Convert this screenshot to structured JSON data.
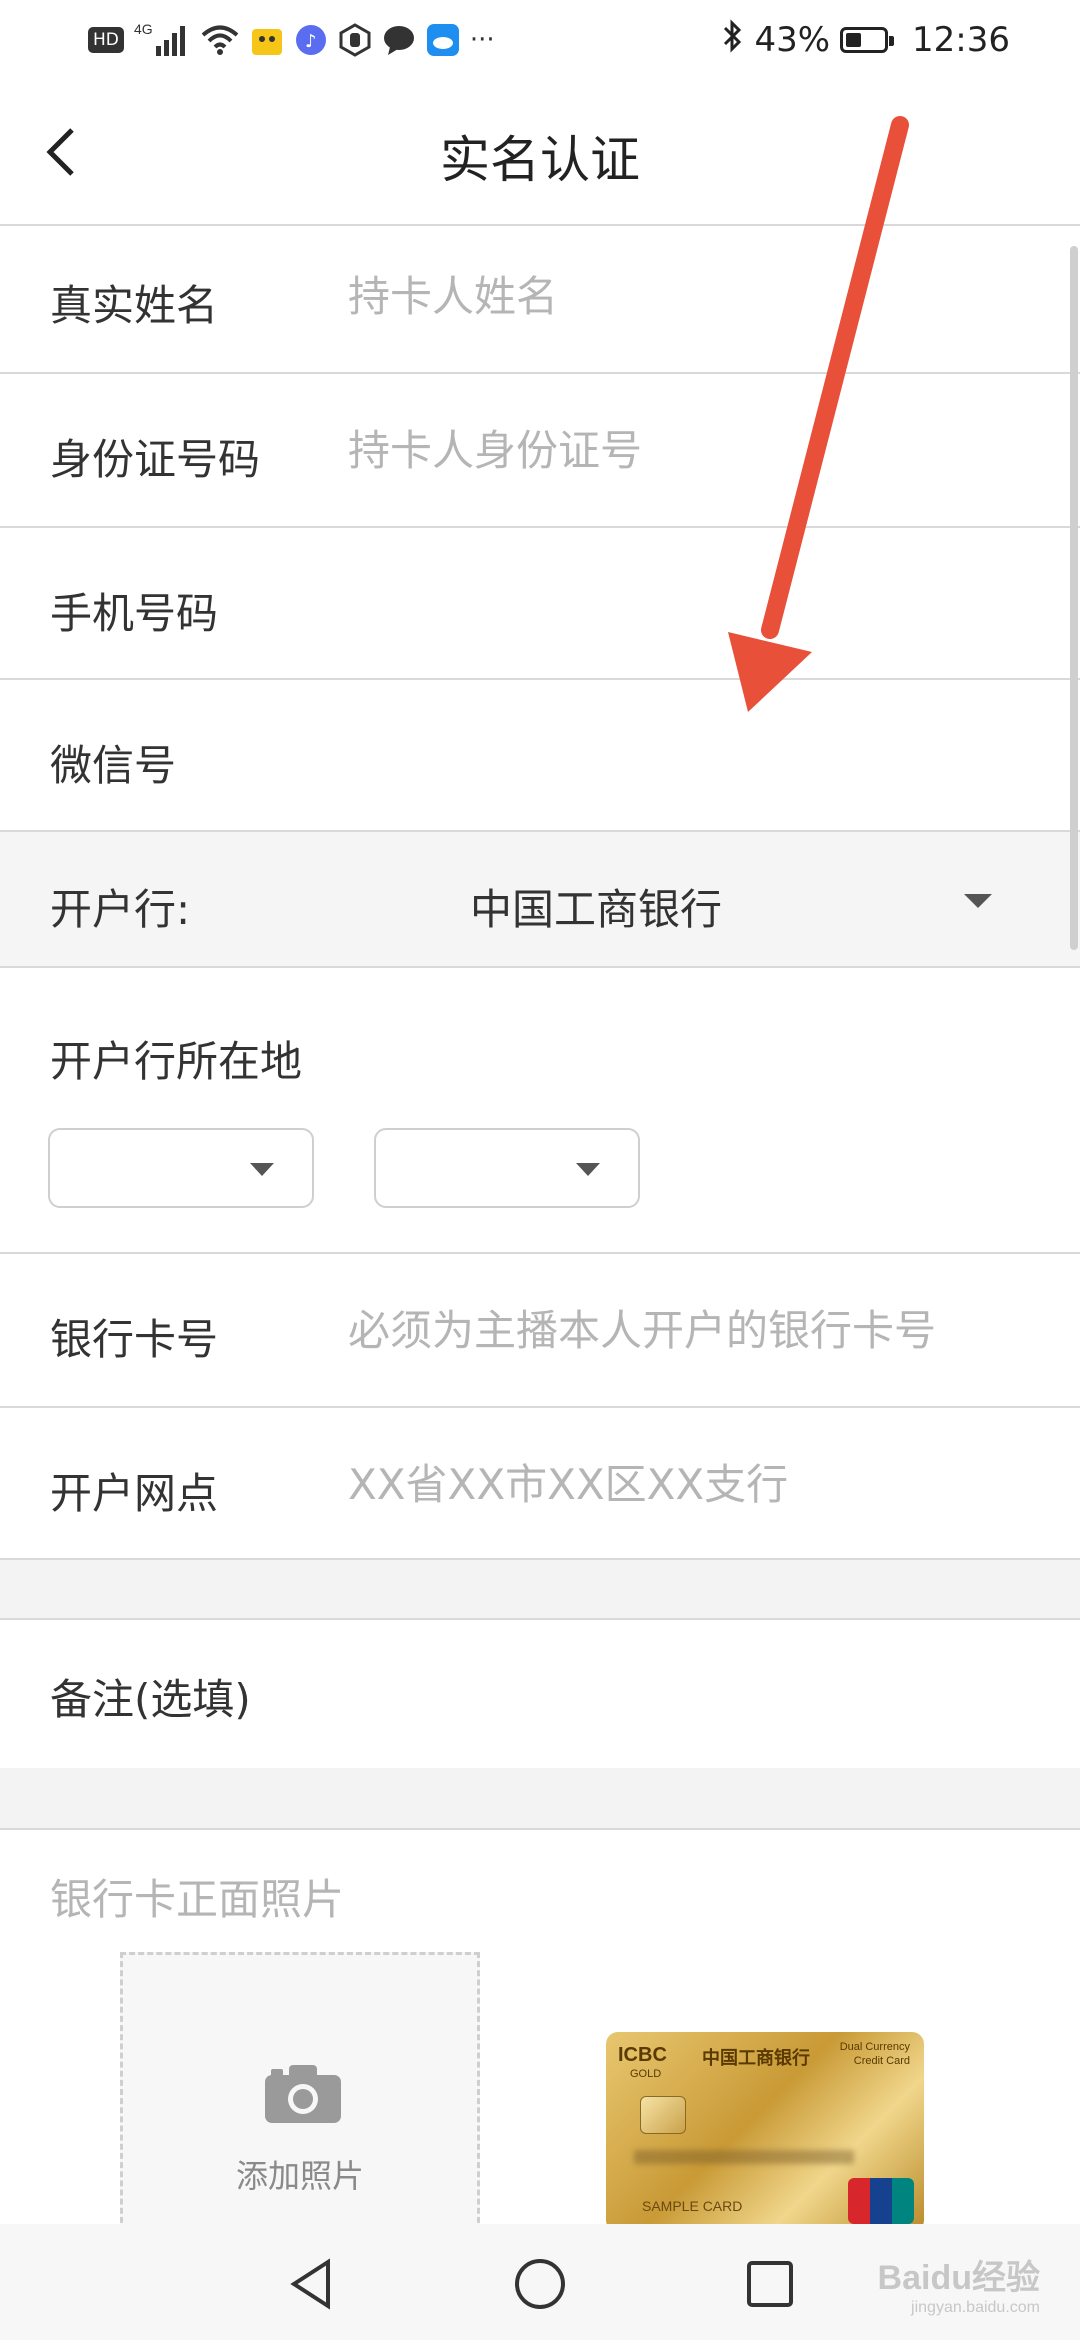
{
  "status_bar": {
    "hd": "HD",
    "net": "4G",
    "battery": "43%",
    "battery_level": 0.43,
    "time": "12:36",
    "more": "···"
  },
  "header": {
    "title": "实名认证",
    "back_icon": "chevron-left-icon"
  },
  "form": {
    "real_name": {
      "label": "真实姓名",
      "placeholder": "持卡人姓名",
      "value": ""
    },
    "id_number": {
      "label": "身份证号码",
      "placeholder": "持卡人身份证号",
      "value": ""
    },
    "phone": {
      "label": "手机号码",
      "placeholder": "",
      "value": ""
    },
    "wechat": {
      "label": "微信号",
      "placeholder": "",
      "value": ""
    },
    "bank": {
      "label": "开户行:",
      "value": "中国工商银行"
    },
    "bank_location": {
      "label": "开户行所在地",
      "province": "",
      "city": ""
    },
    "card_number": {
      "label": "银行卡号",
      "placeholder": "必须为主播本人开户的银行卡号",
      "value": ""
    },
    "branch": {
      "label": "开户网点",
      "placeholder": "XX省XX市XX区XX支行",
      "value": ""
    },
    "remark": {
      "label": "备注(选填)",
      "value": ""
    }
  },
  "photos": {
    "label": "银行卡正面照片",
    "add_label": "添加照片",
    "camera_icon": "camera-icon"
  },
  "sample_card": {
    "brand": "ICBC",
    "bank_name": "中国工商银行",
    "type_line1": "Dual Currency",
    "type_line2": "Credit Card",
    "tier": "GOLD",
    "sample_text": "SAMPLE CARD",
    "network": "UnionPay",
    "network_cn": "银联"
  },
  "watermark": {
    "text": "Baidu经验",
    "sub": "jingyan.baidu.com"
  },
  "colors": {
    "arrow": "#e8503a",
    "placeholder": "#b5b5b5",
    "divider": "#d9d9d9",
    "section_bg": "#f3f3f3"
  }
}
